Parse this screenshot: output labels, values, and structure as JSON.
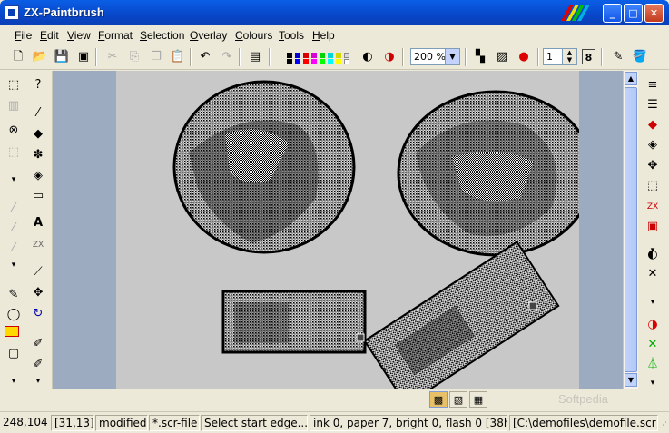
{
  "window": {
    "title": "ZX-Paintbrush"
  },
  "menu": [
    "File",
    "Edit",
    "View",
    "Format",
    "Selection",
    "Overlay",
    "Colours",
    "Tools",
    "Help"
  ],
  "toolbar": {
    "zoom": "200 %",
    "brush_size": "1",
    "brush_max": "8"
  },
  "palette": [
    "#000000",
    "#0000d7",
    "#d70000",
    "#d700d7",
    "#00d700",
    "#00d7d7",
    "#d7d700",
    "#d7d7d7"
  ],
  "status": {
    "coords": "248,104",
    "cell": "[31,13]",
    "modified": "modified",
    "filetype": "*.scr-file",
    "hint": "Select start edge...",
    "attrs": "ink 0, paper 7, bright 0, flash 0 [38h]",
    "path": "[C:\\demofiles\\demofile.scr]"
  },
  "watermark": "Softpedia"
}
